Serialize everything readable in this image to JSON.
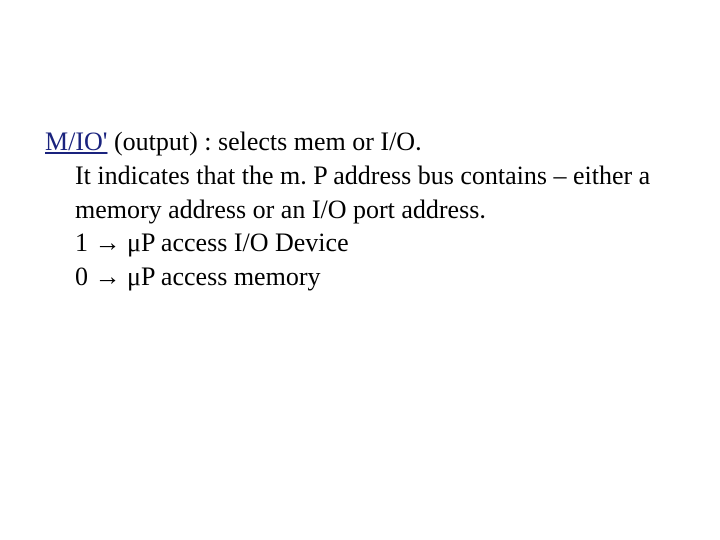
{
  "signal_name": "M/IO'",
  "signal_desc": " (output) : selects mem or I/O.",
  "description": "It indicates that the m. P address bus contains – either a memory address or an I/O port address.",
  "line_high": "1 → μP access I/O Device",
  "line_low": "0 → μP access memory"
}
